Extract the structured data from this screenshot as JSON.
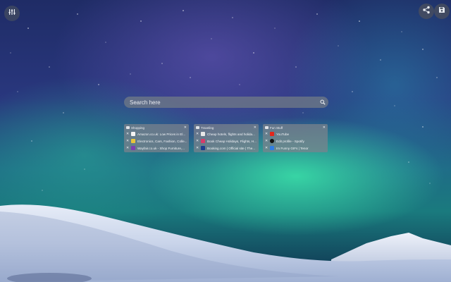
{
  "search": {
    "placeholder": "Search here"
  },
  "groups": [
    {
      "title": "Shopping",
      "links": [
        {
          "label": "Amazon.co.uk: Low Prices in El...",
          "favicon_color": "#f4f4f4"
        },
        {
          "label": "Electronics, Cars, Fashion, Colle...",
          "favicon_color": "#e8c43a"
        },
        {
          "label": "Wayfair.co.uk - Shop Furniture,...",
          "favicon_color": "#7b3fb0"
        }
      ]
    },
    {
      "title": "Traveling",
      "links": [
        {
          "label": "Cheap hotels, flights and holida...",
          "favicon_color": "#e8e8e8"
        },
        {
          "label": "Book Cheap Holidays, Flights, H...",
          "favicon_color": "#d63c6a"
        },
        {
          "label": "Booking.com | Official site | The...",
          "favicon_color": "#1c3e8f"
        }
      ]
    },
    {
      "title": "Fun Stuff",
      "links": [
        {
          "label": "YouTube",
          "favicon_color": "#e3271c"
        },
        {
          "label": "Edit profile - Spotify",
          "favicon_color": "#111111"
        },
        {
          "label": "Im Funny GIFs | Tenor",
          "favicon_color": "#2f7de1"
        }
      ]
    }
  ],
  "icons": {
    "settings": "sliders-icon",
    "share": "share-icon",
    "save": "save-icon",
    "search": "search-icon"
  },
  "colors": {
    "aurora_green": "#3ce6aa",
    "sky_blue": "#29377e"
  }
}
